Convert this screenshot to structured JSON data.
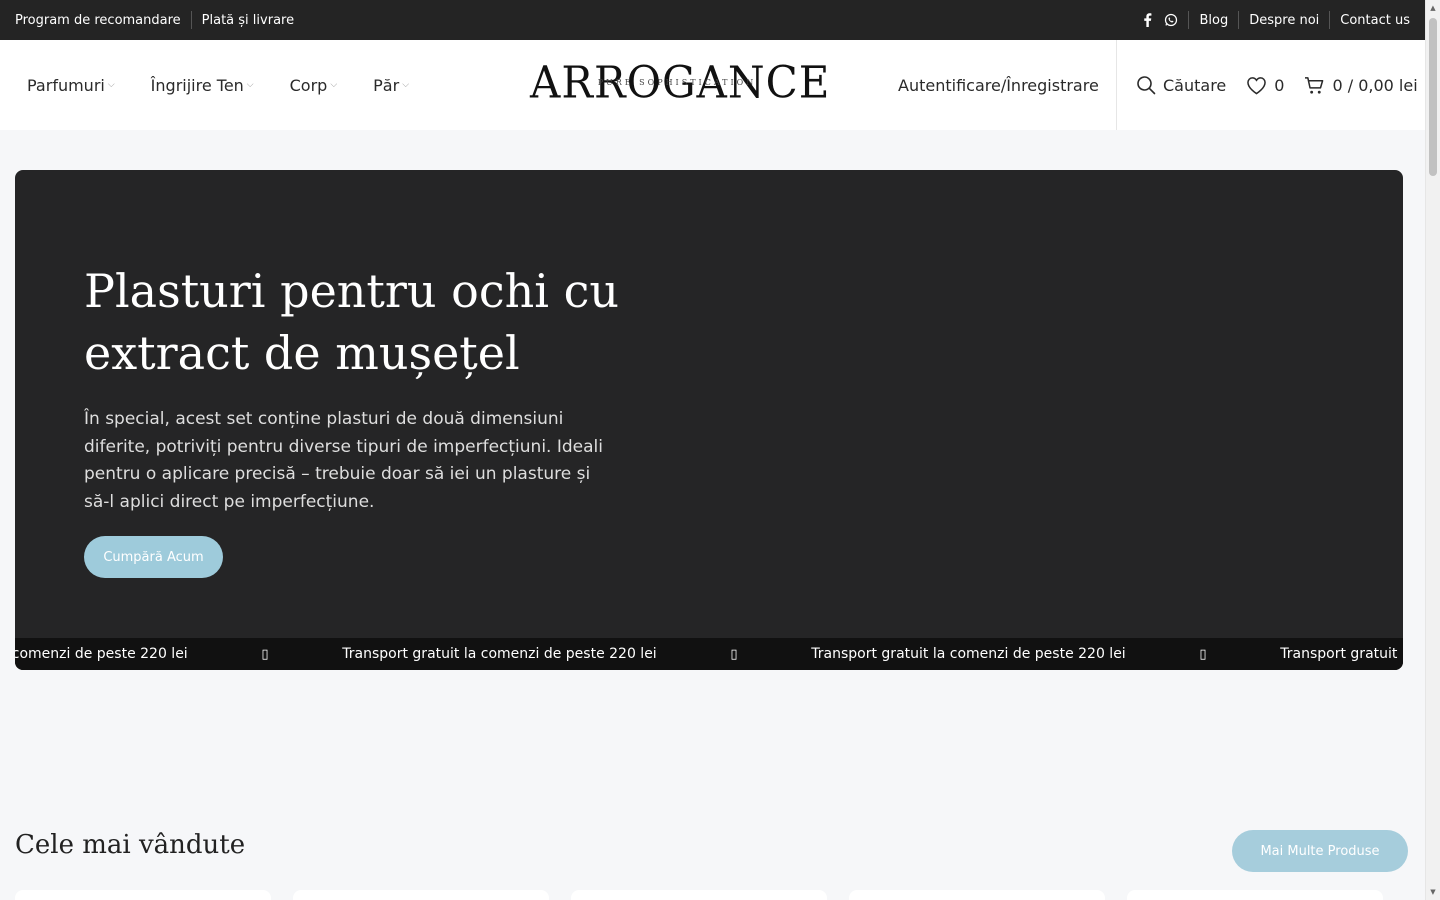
{
  "topbar": {
    "left_links": [
      "Program de recomandare",
      "Plată și livrare"
    ],
    "right_links": [
      "Blog",
      "Despre noi",
      "Contact us"
    ],
    "social_icons": [
      "facebook-icon",
      "whatsapp-icon"
    ]
  },
  "header": {
    "nav": [
      {
        "label": "Parfumuri"
      },
      {
        "label": "Îngrijire Ten"
      },
      {
        "label": "Corp"
      },
      {
        "label": "Păr"
      }
    ],
    "logo": {
      "main": "ARROGANCE",
      "tagline": "PURE SOPHISTICATION"
    },
    "auth_label": "Autentificare/Înregistrare",
    "search_label": "Căutare",
    "wishlist_count": "0",
    "cart_label": "0 / 0,00 lei"
  },
  "hero": {
    "title": "Plasturi pentru ochi cu extract de mușețel",
    "description": "În special, acest set conține plasturi de două dimensiuni diferite, potriviți pentru diverse tipuri de imperfecțiuni. Ideali pentru o aplicare precisă – trebuie doar să iei un plasture și să-l aplici direct pe imperfecțiune.",
    "button_label": "Cumpără Acum",
    "marquee_text": "Transport gratuit la comenzi de peste 220 lei",
    "marquee_glyph": "▯"
  },
  "bestsellers": {
    "title": "Cele mai vândute",
    "more_label": "Mai Multe Produse"
  },
  "colors": {
    "topbar_bg": "#242424",
    "hero_bg": "#252526",
    "accent": "#9ecbdb"
  }
}
